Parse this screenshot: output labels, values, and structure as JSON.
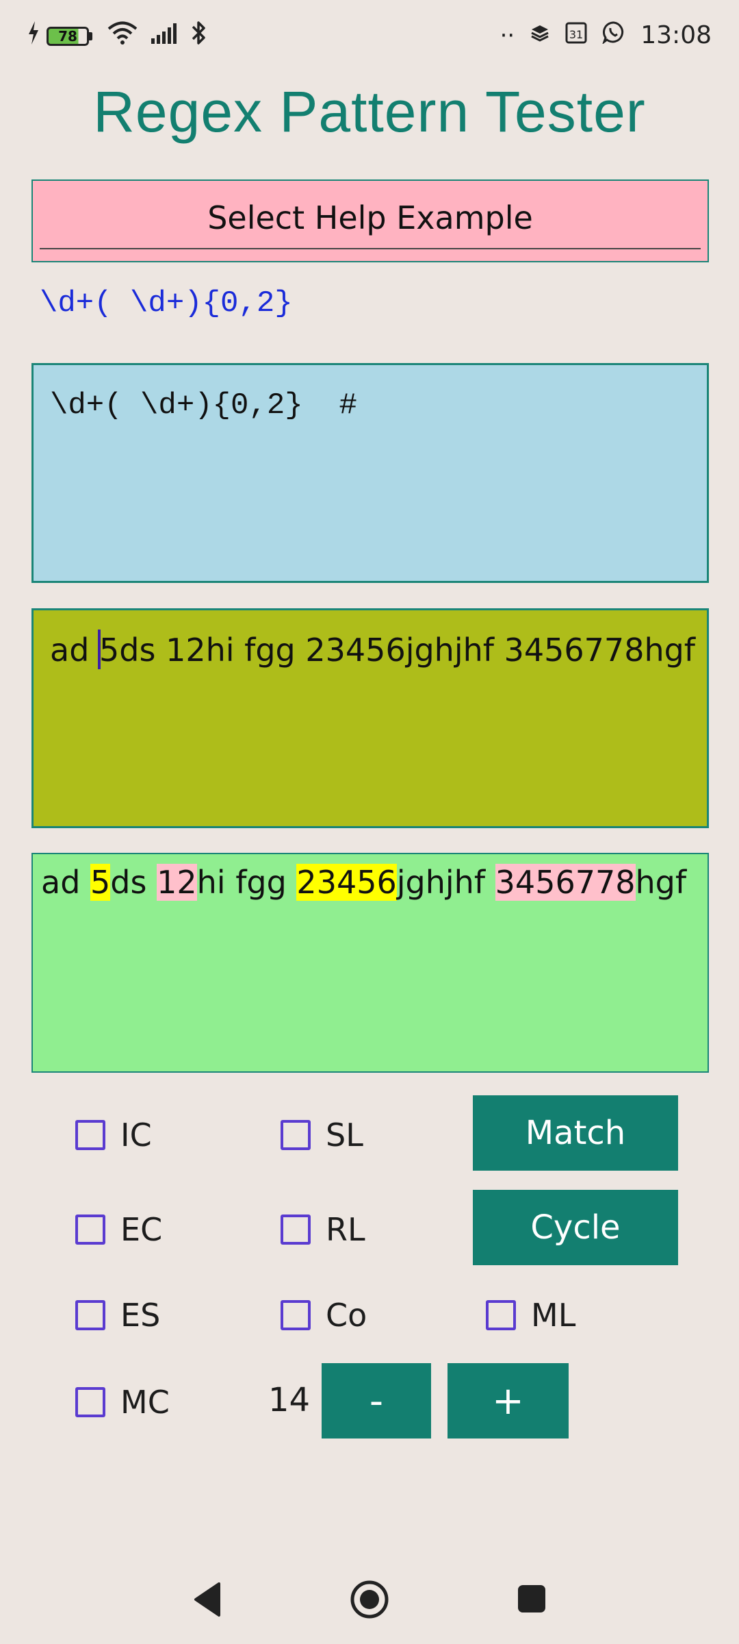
{
  "status_bar": {
    "battery_level": "78",
    "battery_fill_fraction": 0.78,
    "time": "13:08",
    "dots": "··"
  },
  "app": {
    "title": "Regex Pattern Tester"
  },
  "help_select": {
    "label": "Select Help Example"
  },
  "pattern_echo": "\\d+( \\d+){0,2}",
  "pattern_input": {
    "value": "\\d+( \\d+){0,2}  #"
  },
  "test_input": {
    "before_cursor": "ad ",
    "after_cursor": "5ds 12hi fgg 23456jghjhf 3456778hgf"
  },
  "result": {
    "segments": [
      {
        "text": "ad ",
        "highlight": "none"
      },
      {
        "text": "5",
        "highlight": "yellow"
      },
      {
        "text": "ds ",
        "highlight": "none"
      },
      {
        "text": "12",
        "highlight": "pink"
      },
      {
        "text": "hi fgg ",
        "highlight": "none"
      },
      {
        "text": "23456",
        "highlight": "yellow"
      },
      {
        "text": "jghjhf ",
        "highlight": "none"
      },
      {
        "text": "3456778",
        "highlight": "pink"
      },
      {
        "text": "hgf",
        "highlight": "none"
      }
    ]
  },
  "options": {
    "ic": {
      "label": "IC",
      "checked": false
    },
    "sl": {
      "label": "SL",
      "checked": false
    },
    "ec": {
      "label": "EC",
      "checked": false
    },
    "rl": {
      "label": "RL",
      "checked": false
    },
    "es": {
      "label": "ES",
      "checked": false
    },
    "co": {
      "label": "Co",
      "checked": false
    },
    "ml": {
      "label": "ML",
      "checked": false
    },
    "mc": {
      "label": "MC",
      "checked": false
    }
  },
  "buttons": {
    "match": "Match",
    "cycle": "Cycle",
    "minus": "-",
    "plus": "+"
  },
  "font_size_value": "14",
  "colors": {
    "accent": "#137f70",
    "title": "#137f70",
    "pattern_bg": "#add8e6",
    "test_bg": "#aebd1a",
    "result_bg": "#90ee90",
    "help_bg": "#ffb3c1",
    "checkbox": "#5a3bd0",
    "highlight_yellow": "#ffff00",
    "highlight_pink": "#ffc0cb"
  },
  "nav_icons": [
    "back-icon",
    "home-icon",
    "recents-icon"
  ]
}
